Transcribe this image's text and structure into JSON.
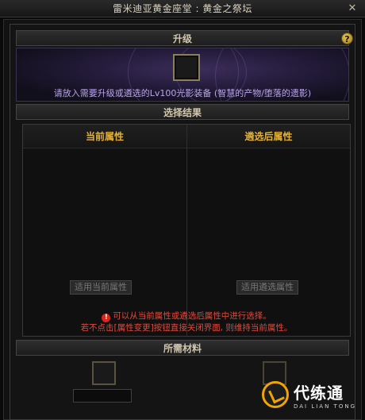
{
  "window": {
    "title": "雷米迪亚黄金座堂 : 黄金之祭坛"
  },
  "upgrade": {
    "header": "升级",
    "hint": "请放入需要升级或遴选的Lv100光影装备 (智慧的产物/堕落的遗影)"
  },
  "selection": {
    "header": "选择结果",
    "current_title": "当前属性",
    "selected_title": "遴选后属性",
    "apply_current": "适用当前属性",
    "apply_selected": "适用遴选属性"
  },
  "warning": {
    "line1": "可以从当前属性或遴选后属性中进行选择。",
    "line2": "若不点击[属性变更]按钮直接关闭界面, 则维持当前属性。"
  },
  "materials": {
    "header": "所需材料"
  },
  "watermark": {
    "text": "代练通",
    "sub": "DAI LIAN TONG"
  },
  "colors": {
    "accent": "#e3b23c",
    "hint": "#b9a6ea",
    "warning": "#e24a3b"
  },
  "icons": {
    "close": "close-icon",
    "help": "question-icon",
    "warning": "exclamation-icon"
  }
}
